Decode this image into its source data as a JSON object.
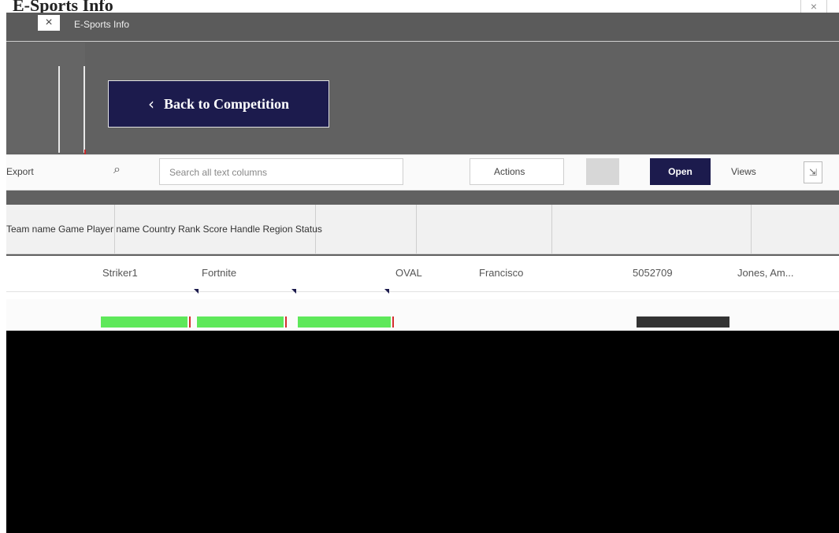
{
  "window": {
    "title": "E-Sports Info",
    "close_glyph": "×",
    "dialog_label": "E-Sports Info"
  },
  "back_button": {
    "label": "Back to Competition",
    "chevron": "‹"
  },
  "toolbar": {
    "left_text": "Export",
    "search_icon": "search-icon",
    "search_placeholder": "Search all text columns",
    "seg_label": "Actions",
    "open_label": "Open",
    "view_label": "Views"
  },
  "table": {
    "header_text": "Team name  Game  Player name  Country  Rank  Score  Handle  Region  Status",
    "row1": [
      "Striker1",
      "Fortnite",
      "OVAL",
      "Francisco",
      "5052709",
      "Jones, Am..."
    ]
  },
  "colors": {
    "navy": "#1c1b4d",
    "backdrop": "#616161",
    "green": "#5ee85a",
    "red": "#d32f2f"
  }
}
